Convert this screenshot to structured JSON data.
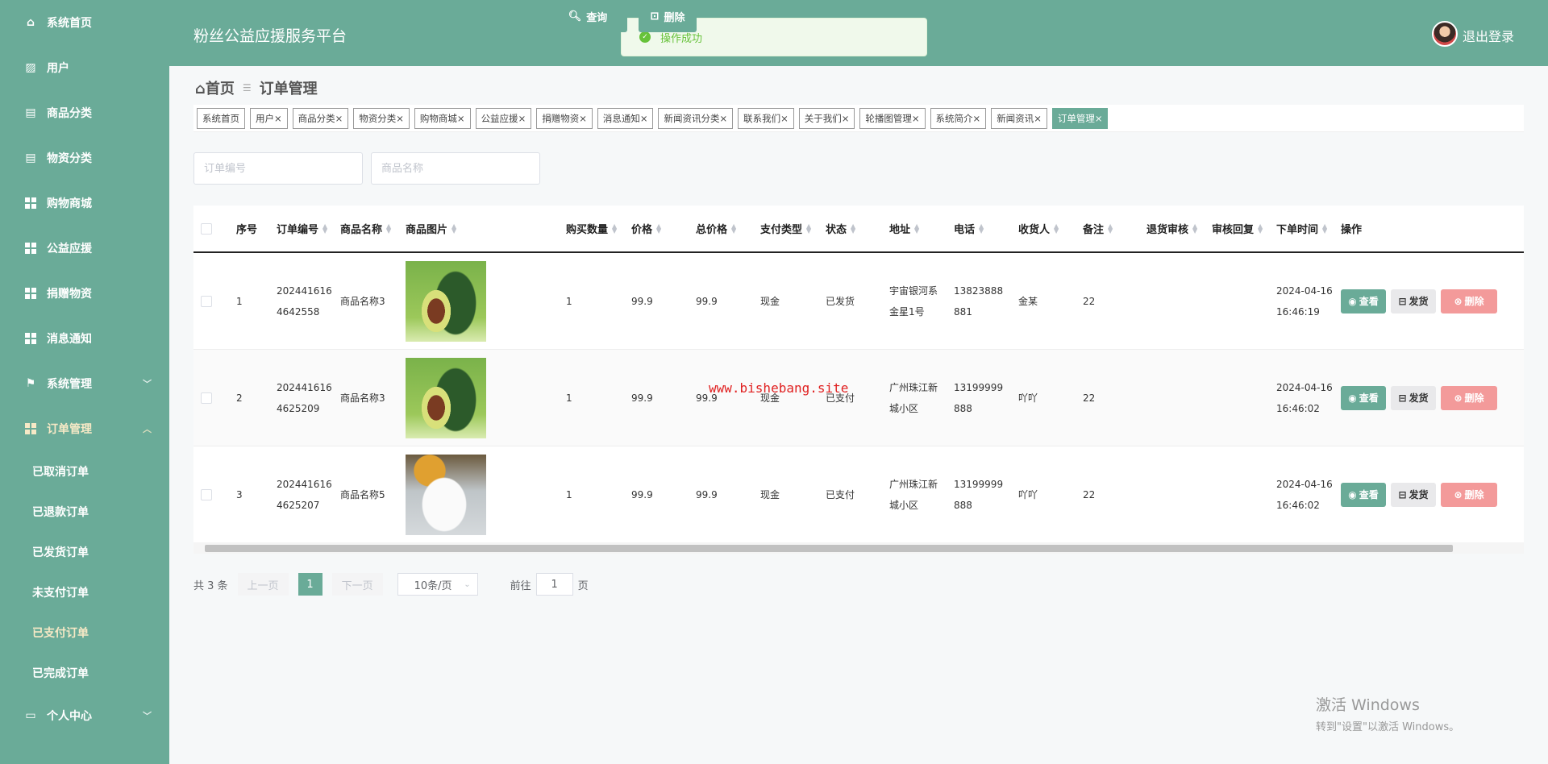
{
  "app": {
    "title": "粉丝公益应援服务平台",
    "logout": "退出登录",
    "toast": "操作成功"
  },
  "sidebar": {
    "items": [
      {
        "label": "系统首页",
        "icon": "home-icon"
      },
      {
        "label": "用户",
        "icon": "user-card-icon"
      },
      {
        "label": "商品分类",
        "icon": "clipboard-icon"
      },
      {
        "label": "物资分类",
        "icon": "clipboard-icon"
      },
      {
        "label": "购物商城",
        "icon": "grid-icon"
      },
      {
        "label": "公益应援",
        "icon": "grid-icon"
      },
      {
        "label": "捐赠物资",
        "icon": "grid-icon"
      },
      {
        "label": "消息通知",
        "icon": "grid-icon"
      },
      {
        "label": "系统管理",
        "icon": "flag-icon"
      },
      {
        "label": "订单管理",
        "icon": "grid-icon"
      }
    ],
    "order_sub": [
      "已取消订单",
      "已退款订单",
      "已发货订单",
      "未支付订单",
      "已支付订单",
      "已完成订单"
    ],
    "personal": "个人中心"
  },
  "breadcrumb": {
    "home": "首页",
    "current": "订单管理"
  },
  "tags": [
    "系统首页",
    "用户",
    "商品分类",
    "物资分类",
    "购物商城",
    "公益应援",
    "捐赠物资",
    "消息通知",
    "新闻资讯分类",
    "联系我们",
    "关于我们",
    "轮播图管理",
    "系统简介",
    "新闻资讯",
    "订单管理"
  ],
  "search": {
    "order_no_placeholder": "订单编号",
    "product_placeholder": "商品名称",
    "query": "查询",
    "delete": "删除"
  },
  "table": {
    "headers": [
      "序号",
      "订单编号",
      "商品名称",
      "商品图片",
      "购买数量",
      "价格",
      "总价格",
      "支付类型",
      "状态",
      "地址",
      "电话",
      "收货人",
      "备注",
      "退货审核",
      "审核回复",
      "下单时间",
      "操作"
    ],
    "rows": [
      {
        "idx": "1",
        "order_no": "2024416164642558",
        "product": "商品名称3",
        "image": "avocado",
        "qty": "1",
        "price": "99.9",
        "total": "99.9",
        "pay": "现金",
        "status": "已发货",
        "address": "宇宙银河系金星1号",
        "phone": "13823888881",
        "receiver": "金某",
        "remark": "22",
        "return_review": "",
        "review_reply": "",
        "date": "2024-04-16",
        "time": "16:46:19"
      },
      {
        "idx": "2",
        "order_no": "2024416164625209",
        "product": "商品名称3",
        "image": "avocado",
        "qty": "1",
        "price": "99.9",
        "total": "99.9",
        "pay": "现金",
        "status": "已支付",
        "address": "广州珠江新城小区",
        "phone": "13199999888",
        "receiver": "吖吖",
        "remark": "22",
        "return_review": "",
        "review_reply": "",
        "date": "2024-04-16",
        "time": "16:46:02"
      },
      {
        "idx": "3",
        "order_no": "2024416164625207",
        "product": "商品名称5",
        "image": "mug",
        "qty": "1",
        "price": "99.9",
        "total": "99.9",
        "pay": "现金",
        "status": "已支付",
        "address": "广州珠江新城小区",
        "phone": "13199999888",
        "receiver": "吖吖",
        "remark": "22",
        "return_review": "",
        "review_reply": "",
        "date": "2024-04-16",
        "time": "16:46:02"
      }
    ],
    "actions": {
      "view": "查看",
      "ship": "发货",
      "delete": "删除"
    }
  },
  "pagination": {
    "total": "共 3 条",
    "prev": "上一页",
    "page": "1",
    "next": "下一页",
    "size": "10条/页",
    "goto": "前往",
    "goto_value": "1",
    "page_unit": "页"
  },
  "watermark": "www.bishebang.site",
  "windows": {
    "line1": "激活 Windows",
    "line2": "转到\"设置\"以激活 Windows。"
  },
  "colors": {
    "primary": "#6aab98",
    "danger": "#f39a9a",
    "success": "#67c23a"
  }
}
